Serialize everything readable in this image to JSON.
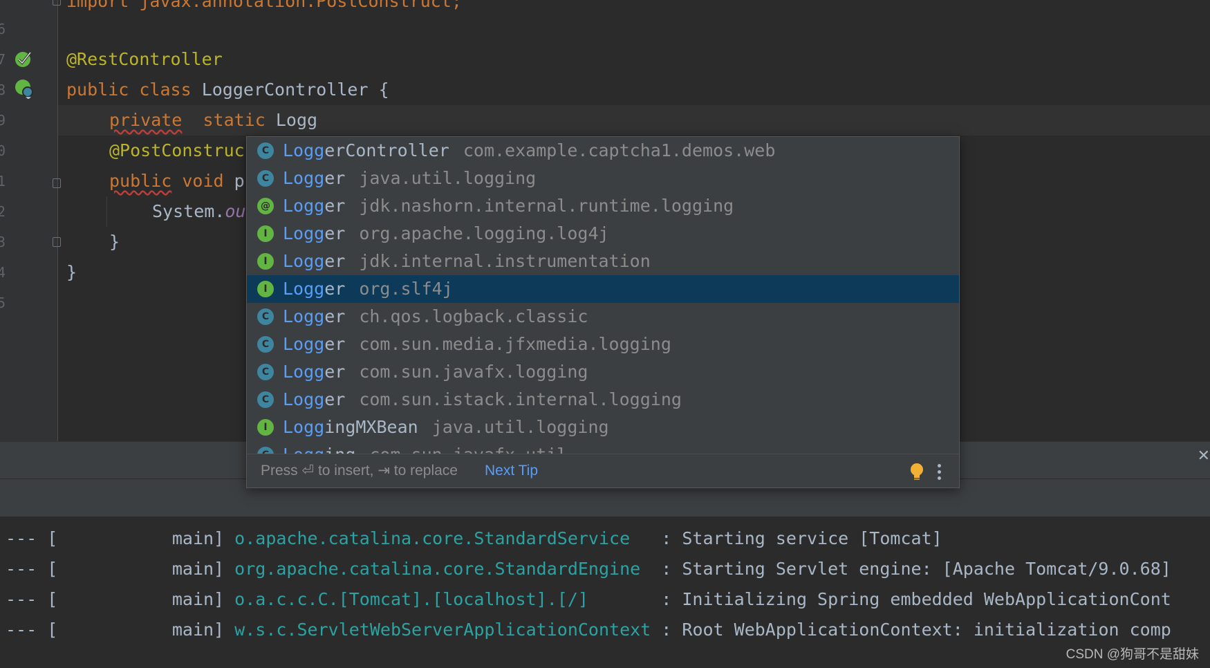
{
  "editor": {
    "line_numbers": [
      "6",
      "7",
      "8",
      "9",
      "0",
      "1",
      "2",
      "3",
      "4",
      "5"
    ],
    "import_line": "import javax.annotation.PostConstruct;",
    "code": {
      "annotation_rest": "@RestController",
      "kw_public": "public",
      "kw_class": "class",
      "class_name": "LoggerController {",
      "kw_private": "private",
      "kw_static": "static",
      "typed": "Logg",
      "annotation_post": "@PostConstruc",
      "kw_public2": "public",
      "kw_void": "void",
      "method_start": "p",
      "system": "System.",
      "out_partial": "ou",
      "close_brace_inner": "}",
      "close_brace_outer": "}"
    }
  },
  "completion": {
    "items": [
      {
        "icon": "C",
        "kind": "class",
        "match": "Logg",
        "rest": "erController",
        "package": "com.example.captcha1.demos.web"
      },
      {
        "icon": "C",
        "kind": "class",
        "match": "Logg",
        "rest": "er",
        "package": "java.util.logging"
      },
      {
        "icon": "@",
        "kind": "annotation",
        "match": "Logg",
        "rest": "er",
        "package": "jdk.nashorn.internal.runtime.logging"
      },
      {
        "icon": "I",
        "kind": "interface",
        "match": "Logg",
        "rest": "er",
        "package": "org.apache.logging.log4j"
      },
      {
        "icon": "I",
        "kind": "interface",
        "match": "Logg",
        "rest": "er",
        "package": "jdk.internal.instrumentation"
      },
      {
        "icon": "I",
        "kind": "interface",
        "match": "Logg",
        "rest": "er",
        "package": "org.slf4j",
        "selected": true
      },
      {
        "icon": "C",
        "kind": "class",
        "match": "Logg",
        "rest": "er",
        "package": "ch.qos.logback.classic"
      },
      {
        "icon": "C",
        "kind": "class",
        "match": "Logg",
        "rest": "er",
        "package": "com.sun.media.jfxmedia.logging"
      },
      {
        "icon": "C",
        "kind": "class",
        "match": "Logg",
        "rest": "er",
        "package": "com.sun.javafx.logging"
      },
      {
        "icon": "C",
        "kind": "class",
        "match": "Logg",
        "rest": "er",
        "package": "com.sun.istack.internal.logging"
      },
      {
        "icon": "I",
        "kind": "interface",
        "match": "Logg",
        "rest": "ingMXBean",
        "package": "java.util.logging"
      },
      {
        "icon": "C",
        "kind": "class",
        "match": "Logg",
        "rest": "ing",
        "package": "com.sun.javafx.util"
      }
    ],
    "footer": {
      "hint": "Press ⏎ to insert, ⇥ to replace",
      "next_tip": "Next Tip"
    }
  },
  "console": {
    "lines": [
      {
        "prefix": "--- [",
        "thread": "main]",
        "logger": "o.apache.catalina.core.StandardService",
        "message": ": Starting service [Tomcat]"
      },
      {
        "prefix": "--- [",
        "thread": "main]",
        "logger": "org.apache.catalina.core.StandardEngine",
        "message": ": Starting Servlet engine: [Apache Tomcat/9.0.68]"
      },
      {
        "prefix": "--- [",
        "thread": "main]",
        "logger": "o.a.c.c.C.[Tomcat].[localhost].[/]",
        "message": ": Initializing Spring embedded WebApplicationCont"
      },
      {
        "prefix": "--- [",
        "thread": "main]",
        "logger": "w.s.c.ServletWebServerApplicationContext",
        "message": ": Root WebApplicationContext: initialization comp"
      }
    ]
  },
  "watermark": "CSDN @狗哥不是甜妹",
  "colors": {
    "editor_bg": "#2b2b2b",
    "keyword": "#cc7832",
    "annotation": "#bbb529",
    "match": "#589df6",
    "selection": "#0d3a58",
    "logger_cyan": "#2ba3a3"
  }
}
